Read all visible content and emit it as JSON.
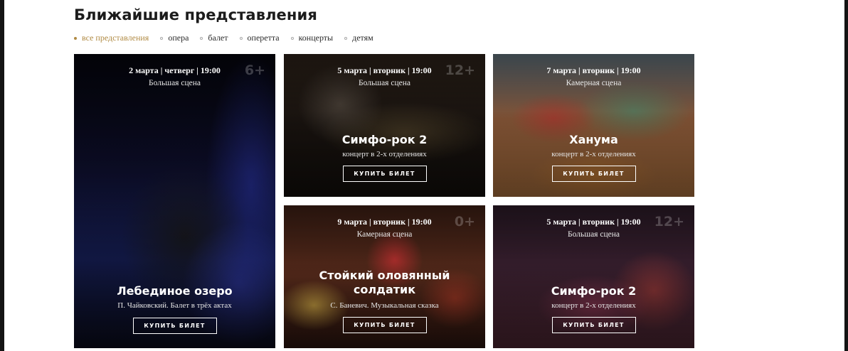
{
  "heading": "Ближайшие представления",
  "filters": [
    {
      "label": "все представления",
      "active": true
    },
    {
      "label": "опера",
      "active": false
    },
    {
      "label": "балет",
      "active": false
    },
    {
      "label": "оперетта",
      "active": false
    },
    {
      "label": "концерты",
      "active": false
    },
    {
      "label": "детям",
      "active": false
    }
  ],
  "cards": [
    {
      "date": "2 марта | четверг | 19:00",
      "venue": "Большая сцена",
      "age": "6+",
      "title": "Лебединое озеро",
      "subtitle": "П. Чайковский. Балет в трёх актах",
      "button": "КУПИТЬ БИЛЕТ"
    },
    {
      "date": "5 марта | вторник | 19:00",
      "venue": "Большая сцена",
      "age": "12+",
      "title": "Симфо-рок 2",
      "subtitle": "концерт в 2-х отделениях",
      "button": "КУПИТЬ БИЛЕТ"
    },
    {
      "date": "7 марта | вторник | 19:00",
      "venue": "Камерная сцена",
      "age": "",
      "title": "Ханума",
      "subtitle": "концерт в 2-х отделениях",
      "button": "КУПИТЬ БИЛЕТ"
    },
    {
      "date": "9 марта | вторник | 19:00",
      "venue": "Камерная сцена",
      "age": "0+",
      "title": "Стойкий оловянный солдатик",
      "subtitle": "С. Баневич. Музыкальная сказка",
      "button": "КУПИТЬ БИЛЕТ"
    },
    {
      "date": "5 марта | вторник | 19:00",
      "venue": "Большая сцена",
      "age": "12+",
      "title": "Симфо-рок 2",
      "subtitle": "концерт в 2-х отделениях",
      "button": "КУПИТЬ БИЛЕТ"
    }
  ]
}
